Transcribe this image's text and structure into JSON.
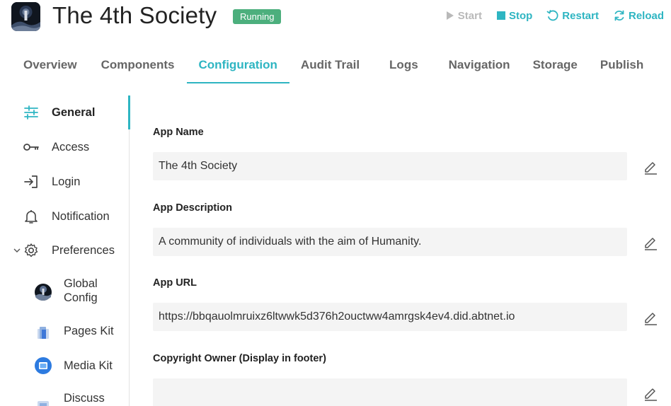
{
  "header": {
    "title": "The 4th Society",
    "status": "Running",
    "actions": {
      "start": "Start",
      "stop": "Stop",
      "restart": "Restart",
      "reload": "Reload"
    }
  },
  "tabs": [
    {
      "label": "Overview"
    },
    {
      "label": "Components"
    },
    {
      "label": "Configuration",
      "selected": true
    },
    {
      "label": "Audit Trail"
    },
    {
      "label": "Logs"
    },
    {
      "label": "Navigation"
    },
    {
      "label": "Storage"
    },
    {
      "label": "Publish"
    }
  ],
  "sidebar": {
    "items": [
      {
        "label": "General",
        "icon": "sliders-icon",
        "selected": true
      },
      {
        "label": "Access",
        "icon": "key-icon"
      },
      {
        "label": "Login",
        "icon": "login-icon"
      },
      {
        "label": "Notification",
        "icon": "bell-icon"
      },
      {
        "label": "Preferences",
        "icon": "gear-icon",
        "expanded": true
      }
    ],
    "sub_items": [
      {
        "label1": "Global",
        "label2": "Config",
        "icon": "global-config-icon"
      },
      {
        "label": "Pages Kit",
        "icon": "pages-kit-icon"
      },
      {
        "label": "Media Kit",
        "icon": "media-kit-icon"
      },
      {
        "label": "Discuss",
        "icon": "discuss-icon"
      }
    ]
  },
  "form": {
    "fields": [
      {
        "label": "App Name",
        "value": "The 4th Society"
      },
      {
        "label": "App Description",
        "value": "A community of individuals with the aim of Humanity."
      },
      {
        "label": "App URL",
        "value": "https://bbqauolmruixz6ltwwk5d376h2ouctww4amrgsk4ev4.did.abtnet.io"
      },
      {
        "label": "Copyright Owner (Display in footer)",
        "value": ""
      }
    ]
  },
  "colors": {
    "accent": "#2eb5c2",
    "running": "#4caf7d",
    "disabled": "#b9b9b9",
    "field_bg": "#f4f4f4"
  }
}
